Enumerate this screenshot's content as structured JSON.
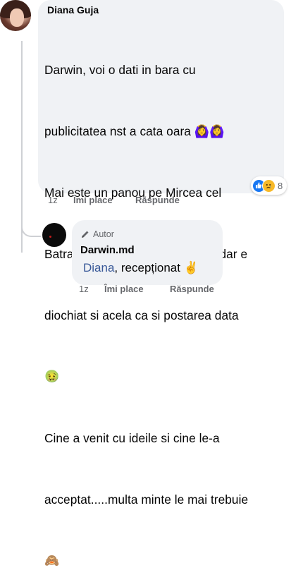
{
  "comment": {
    "author": "Diana Guja",
    "lines": [
      "Darwin, voi o dati in bara cu",
      "publicitatea nst a cata oara 🙆‍♀️🙆‍♀️",
      "Mai este un panou pe Mircea cel",
      "Batran (pacat ca nu am poza)....dar e",
      "diochiat si acela ca si postarea data",
      "🤢",
      "Cine a venit cu ideile si cine le-a",
      "acceptat.....multa minte le mai trebuie",
      "🙈"
    ],
    "reactions": {
      "icons": [
        "like-icon",
        "sad-icon"
      ],
      "count": "8"
    },
    "actions": {
      "time": "1z",
      "like": "Îmi place",
      "reply": "Răspunde"
    }
  },
  "reply": {
    "badge": "Autor",
    "author": "Darwin.md",
    "mention": "Diana",
    "text": ", recepționat ✌️",
    "actions": {
      "time": "1z",
      "like": "Îmi place",
      "reply": "Răspunde"
    }
  },
  "colors": {
    "bubble": "#f0f2f5",
    "muted": "#65676b",
    "mention": "#385898",
    "like": "#1877f2",
    "sad": "#f7b928"
  }
}
